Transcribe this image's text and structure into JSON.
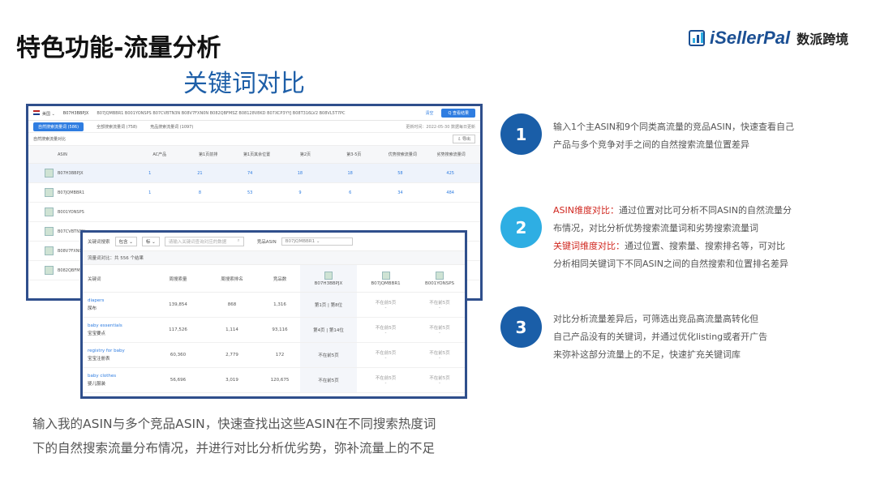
{
  "title": "特色功能-流量分析",
  "subtitle": "关键词对比",
  "logo": {
    "brand": "iSellerPal",
    "cn": "数派跨境"
  },
  "shot": {
    "marketplace": "美国",
    "main_asin": "B07H3BBPJX",
    "compare_asins": "B07JQMBBR1  B001YONSPS  B07CVBTN3N  B08V7FXN0N  B082QBFMSZ  B08128V8KD  B07XCP3YYJ  B08T316LV2  B08VL5T7PC",
    "clear": "清空",
    "query_btn": "Q 查看结果",
    "tabs": [
      "自然搜索流量词 (586)",
      "全部搜索流量词 (758)",
      "竞品搜索流量词 (1097)"
    ],
    "updated": "更新时间：2022-05-30 数据每日更新",
    "section": "自然搜索流量对比",
    "export": "导出",
    "headers": [
      "ASIN",
      "AC产品",
      "第1页前排",
      "第1页其余位置",
      "第2页",
      "第3-5页",
      "优势搜索流量词",
      "劣势搜索流量词"
    ],
    "rows": [
      {
        "asin": "B07H3BBPJX",
        "v": [
          "1",
          "21",
          "74",
          "18",
          "18",
          "58",
          "425"
        ]
      },
      {
        "asin": "B07JQMBBR1",
        "v": [
          "1",
          "8",
          "53",
          "9",
          "6",
          "34",
          "484"
        ]
      },
      {
        "asin": "B001YONSPS",
        "v": [
          "",
          "",
          "",
          "",
          "",
          "",
          ""
        ]
      },
      {
        "asin": "B07CVBTN3N",
        "v": [
          "",
          "",
          "",
          "",
          "",
          "",
          ""
        ]
      },
      {
        "asin": "B08V7FXN0N",
        "v": [
          "",
          "",
          "",
          "",
          "",
          "",
          ""
        ]
      },
      {
        "asin": "B082QBFMSZ",
        "v": [
          "",
          "",
          "",
          "",
          "",
          "",
          ""
        ]
      }
    ]
  },
  "overlay": {
    "filter_label": "关键词搜索",
    "filter_op": "包含",
    "filter_field": "标",
    "search_placeholder": "请输入关键词查询对应的数据",
    "asin_label": "竞品ASIN",
    "asin_value": "B07JQMBBR1",
    "summary": "流量词对比：共 556 个结果",
    "headers": [
      "关键词",
      "周搜索量",
      "周搜索排名",
      "竞品数"
    ],
    "asins": [
      "B07H3BBPJX",
      "B07JQMBBR1",
      "B001YONSPS"
    ],
    "rows": [
      {
        "en": "diapers",
        "cn": "尿布",
        "vol": "139,854",
        "rank": "868",
        "comp": "1,316",
        "a1": "第1页 | 第8位",
        "a2": "不在前5页",
        "a3": "不在前5页"
      },
      {
        "en": "baby essentials",
        "cn": "宝宝要点",
        "vol": "117,526",
        "rank": "1,114",
        "comp": "93,116",
        "a1": "第4页 | 第14位",
        "a2": "不在前5页",
        "a3": "不在前5页"
      },
      {
        "en": "registry for baby",
        "cn": "宝宝注册表",
        "vol": "60,360",
        "rank": "2,779",
        "comp": "172",
        "a1": "不在前5页",
        "a2": "不在前5页",
        "a3": "不在前5页"
      },
      {
        "en": "baby clothes",
        "cn": "婴儿服装",
        "vol": "56,696",
        "rank": "3,019",
        "comp": "120,675",
        "a1": "不在前5页",
        "a2": "不在前5页",
        "a3": "不在前5页"
      }
    ]
  },
  "steps": {
    "s1": {
      "num": "1",
      "line1": "输入1个主ASIN和9个同类高流量的竞品ASIN，快速查看自己",
      "line2": "产品与多个竞争对手之间的自然搜索流量位置差异"
    },
    "s2": {
      "num": "2",
      "h1": "ASIN维度对比：",
      "t1": "通过位置对比可分析不同ASIN的自然流量分",
      "t1b": "布情况，对比分析优势搜索流量词和劣势搜索流量词",
      "h2": "关键词维度对比：",
      "t2": "通过位置、搜索量、搜索排名等，可对比",
      "t2b": "分析相同关键词下不同ASIN之间的自然搜索和位置排名差异"
    },
    "s3": {
      "num": "3",
      "line1": "对比分析流量差异后，可筛选出竞品高流量高转化但",
      "line2": "自己产品没有的关键词，并通过优化listing或者开广告",
      "line3": "来弥补这部分流量上的不足，快速扩充关键词库"
    }
  },
  "bottom": {
    "line1": "输入我的ASIN与多个竞品ASIN，快速查找出这些ASIN在不同搜索热度词",
    "line2": "下的自然搜索流量分布情况，并进行对比分析优劣势，弥补流量上的不足"
  },
  "colors": {
    "accent": "#1a5ea8",
    "accent_light": "#2eaee3",
    "frame": "#2f4f8c",
    "red": "#d0261e"
  }
}
